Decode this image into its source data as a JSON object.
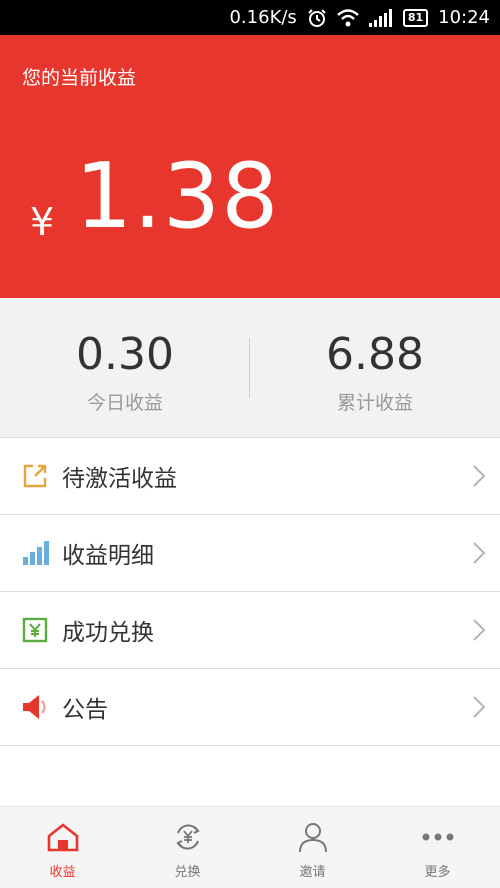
{
  "status_bar": {
    "speed": "0.16K/s",
    "battery": "81",
    "time": "10:24"
  },
  "hero": {
    "title": "您的当前收益",
    "currency": "¥",
    "amount": "1.38",
    "color": "#e7362d"
  },
  "stats": {
    "today": {
      "value": "0.30",
      "label": "今日收益"
    },
    "total": {
      "value": "6.88",
      "label": "累计收益"
    }
  },
  "menu": [
    {
      "label": "待激活收益",
      "icon": "external-link-icon",
      "color": "#e8a33a"
    },
    {
      "label": "收益明细",
      "icon": "bar-chart-icon",
      "color": "#6aaee0"
    },
    {
      "label": "成功兑换",
      "icon": "yen-icon",
      "color": "#5aad3c"
    },
    {
      "label": "公告",
      "icon": "speaker-icon",
      "color": "#e7362d"
    }
  ],
  "bottom_nav": [
    {
      "label": "收益",
      "icon": "home-icon",
      "active": true
    },
    {
      "label": "兑换",
      "icon": "exchange-icon",
      "active": false
    },
    {
      "label": "邀请",
      "icon": "person-icon",
      "active": false
    },
    {
      "label": "更多",
      "icon": "more-icon",
      "active": false
    }
  ]
}
